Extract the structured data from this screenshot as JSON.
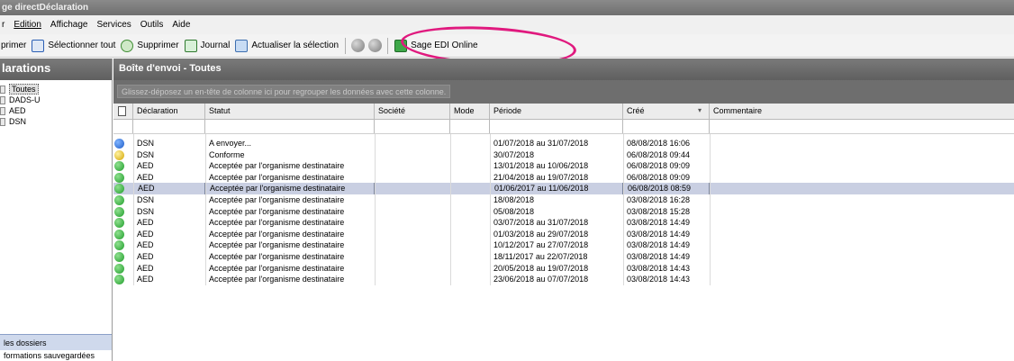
{
  "window": {
    "title": "ge directDéclaration"
  },
  "menu": [
    "r",
    "Edition",
    "Affichage",
    "Services",
    "Outils",
    "Aide"
  ],
  "toolbar": {
    "print_label": "primer",
    "select_all_label": "Sélectionner tout",
    "delete_label": "Supprimer",
    "journal_label": "Journal",
    "refresh_label": "Actualiser la sélection",
    "sage_edi_label": "Sage EDI Online"
  },
  "sidebar": {
    "title": "larations",
    "items": [
      {
        "label": "Toutes",
        "selected": true
      },
      {
        "label": "DADS-U"
      },
      {
        "label": "AED"
      },
      {
        "label": "DSN"
      }
    ],
    "bottom_items": [
      "les dossiers",
      "formations sauvegardées"
    ]
  },
  "main": {
    "title": "Boîte d'envoi - Toutes",
    "group_hint": "Glissez-déposez un en-tête de colonne ici pour regrouper les données avec cette colonne.",
    "columns": [
      "Déclaration",
      "Statut",
      "Société",
      "Mode",
      "Période",
      "Créé",
      "Commentaire"
    ],
    "rows": [
      {
        "status_color": "blue",
        "declaration": "DSN",
        "statut": "A envoyer...",
        "periode": "01/07/2018 au 31/07/2018",
        "cree": "08/08/2018 16:06"
      },
      {
        "status_color": "yellow",
        "declaration": "DSN",
        "statut": "Conforme",
        "periode": "30/07/2018",
        "cree": "06/08/2018 09:44"
      },
      {
        "status_color": "green",
        "declaration": "AED",
        "statut": "Acceptée par l'organisme destinataire",
        "periode": "13/01/2018 au 10/06/2018",
        "cree": "06/08/2018 09:09"
      },
      {
        "status_color": "green",
        "declaration": "AED",
        "statut": "Acceptée par l'organisme destinataire",
        "periode": "21/04/2018 au 19/07/2018",
        "cree": "06/08/2018 09:09"
      },
      {
        "status_color": "green",
        "declaration": "AED",
        "statut": "Acceptée par l'organisme destinataire",
        "periode": "01/06/2017 au 11/06/2018",
        "cree": "06/08/2018 08:59",
        "selected": true
      },
      {
        "status_color": "green",
        "declaration": "DSN",
        "statut": "Acceptée par l'organisme destinataire",
        "periode": "18/08/2018",
        "cree": "03/08/2018 16:28"
      },
      {
        "status_color": "green",
        "declaration": "DSN",
        "statut": "Acceptée par l'organisme destinataire",
        "periode": "05/08/2018",
        "cree": "03/08/2018 15:28"
      },
      {
        "status_color": "green",
        "declaration": "AED",
        "statut": "Acceptée par l'organisme destinataire",
        "periode": "03/07/2018 au 31/07/2018",
        "cree": "03/08/2018 14:49"
      },
      {
        "status_color": "green",
        "declaration": "AED",
        "statut": "Acceptée par l'organisme destinataire",
        "periode": "01/03/2018 au 29/07/2018",
        "cree": "03/08/2018 14:49"
      },
      {
        "status_color": "green",
        "declaration": "AED",
        "statut": "Acceptée par l'organisme destinataire",
        "periode": "10/12/2017 au 27/07/2018",
        "cree": "03/08/2018 14:49"
      },
      {
        "status_color": "green",
        "declaration": "AED",
        "statut": "Acceptée par l'organisme destinataire",
        "periode": "18/11/2017 au 22/07/2018",
        "cree": "03/08/2018 14:49"
      },
      {
        "status_color": "green",
        "declaration": "AED",
        "statut": "Acceptée par l'organisme destinataire",
        "periode": "20/05/2018 au 19/07/2018",
        "cree": "03/08/2018 14:43"
      },
      {
        "status_color": "green",
        "declaration": "AED",
        "statut": "Acceptée par l'organisme destinataire",
        "periode": "23/06/2018 au 07/07/2018",
        "cree": "03/08/2018 14:43"
      }
    ]
  },
  "colors": {
    "selected_row": "#c9cfe2",
    "highlight": "#e0197e",
    "header_gray": "#6e6e6e"
  }
}
